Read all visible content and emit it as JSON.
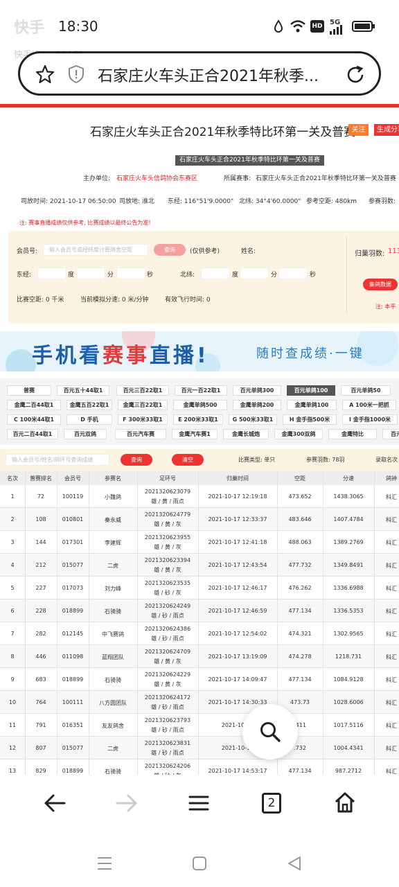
{
  "status": {
    "time": "18:30",
    "watermark": "快手",
    "watermark_id": "快手ID:qv01081",
    "battery": "",
    "signal": "5G"
  },
  "address_bar": {
    "title": "石家庄火车头正合2021年秋季..."
  },
  "page": {
    "title": "石家庄火车头正合2021年秋季特比环第一关及普赛",
    "follow_label": "关注",
    "share_label": "生成分享",
    "sub_banner": "石家庄火车头正合2021年秋季特比环第一关及普赛",
    "organizer_label": "主办单位:",
    "organizer": "石家庄火车头信鸽协会东赛区",
    "event_label": "所属赛事:",
    "event": "石家庄火车头正合2021年秋季特比环第一关及普赛",
    "release_time": "司放时间: 2021-10-17 06:50:00",
    "release_place": "司放地: 淮北",
    "longitude": "东经: 116°51'9.0000\"",
    "latitude": "北纬: 34°4'60.0000\"",
    "ref_distance": "参考空距: 480km",
    "entry_count": "参赛羽数:",
    "notice": "注: 赛事直播成绩仅供参考, 比赛成绩以最终公告为准!"
  },
  "search_panel": {
    "member_label": "会员号:",
    "member_placeholder": "输入会员号或经纬度计算随舍空距",
    "query_button": "查询",
    "query_note": "(仅供参考)",
    "name_label": "姓名:",
    "homing_label": "归巢羽数:",
    "homing_value": "113",
    "lon_label": "东经:",
    "lat_label": "北纬:",
    "deg": "度",
    "min": "分",
    "sec": "秒",
    "collect_button": "集鸽数据",
    "remark": "注: 本平",
    "distance": "比赛空距: 0 千米",
    "speed": "当前模拟分速: 0 米/分钟",
    "valid_time": "有效飞行时间: 0"
  },
  "ad": {
    "headline_pre": "手机看",
    "headline_hl": "赛事",
    "headline_post": "直播!",
    "tagline": "随时查成绩·一键"
  },
  "tabs": [
    [
      "普赛",
      "百元五十44取1",
      "百元三百22取1",
      "百元一百22取1",
      "百元单鸽300",
      "百元单鸽100",
      "百元单鸽50"
    ],
    [
      "金鹰二百44取1",
      "金鹰五百22取1",
      "金鹰三百22取1",
      "金鹰单鸽500",
      "金鹰单鸽200",
      "金鹰单鸽100",
      "A 100米一把抓"
    ],
    [
      "C 100米44取1",
      "D 手机",
      "F 300米33取1",
      "E 200米33取1",
      "G 500米33取1",
      "H 金手指500米",
      "I 金手指1000米"
    ],
    [
      "百元二百44取1",
      "百元双鸽",
      "百元汽车赛",
      "金鹰汽车赛1",
      "金鹰长城炮",
      "金鹰300双鸽",
      "金鹰特比",
      "百元"
    ]
  ],
  "active_tab": "百元单鸽100",
  "table_toolbar": {
    "search_placeholder": "输入会员号/姓名/鸽环号查询成绩",
    "query_button": "查询",
    "clear_button": "清空",
    "match_type": "比赛类型: 单只",
    "entries": "参赛羽数: 78羽",
    "admitted": "录取名次"
  },
  "table": {
    "headers": [
      "名次",
      "普赛排名",
      "会员号",
      "参赛名",
      "足环号",
      "归巢时间",
      "空距",
      "分速",
      "鸽钟"
    ],
    "rows": [
      [
        "1",
        "72",
        "100119",
        "小魏鸽",
        "2021320623079",
        "雄 / 黄 / 雨点",
        "2021-10-17 12:19:18",
        "473.652",
        "1438.3065",
        "科汇"
      ],
      [
        "2",
        "108",
        "010801",
        "秦永威",
        "2021320624779",
        "雄 / 黄 / 灰",
        "2021-10-17 12:33:37",
        "483.646",
        "1407.4784",
        "科汇"
      ],
      [
        "3",
        "144",
        "017301",
        "李建辉",
        "2021320623955",
        "雄 / 黄 / 灰",
        "2021-10-17 12:41:18",
        "488.063",
        "1389.2769",
        "科汇"
      ],
      [
        "4",
        "212",
        "015077",
        "二虎",
        "2021320623394",
        "雄 / 黄 / 灰",
        "2021-10-17 12:43:54",
        "477.732",
        "1349.8491",
        "科汇"
      ],
      [
        "5",
        "227",
        "017073",
        "刘力峰",
        "2021320623535",
        "雄 / 砂 / 灰",
        "2021-10-17 12:46:17",
        "476.262",
        "1336.6988",
        "科汇"
      ],
      [
        "6",
        "228",
        "018899",
        "石骑骑",
        "2021320624249",
        "雄 / 砂 / 雨点",
        "2021-10-17 12:46:59",
        "477.134",
        "1336.5353",
        "科汇"
      ],
      [
        "7",
        "282",
        "012145",
        "中飞赛鸽",
        "2021320624386",
        "雄 / 砂 / 雨点",
        "2021-10-17 12:54:02",
        "474.321",
        "1302.9565",
        "科汇"
      ],
      [
        "8",
        "446",
        "011098",
        "蓝翔团队",
        "2021320624709",
        "雄 / 黄 / 灰",
        "2021-10-17 13:19:09",
        "474.278",
        "1218.731",
        "科汇"
      ],
      [
        "9",
        "683",
        "018899",
        "石骑骑",
        "2021320624229",
        "雄 / 黄 / 灰",
        "2021-10-17 14:09:47",
        "477.134",
        "1084.9128",
        "科汇"
      ],
      [
        "10",
        "764",
        "100111",
        "八方圆团队",
        "2021320624172",
        "雄 / 砂 / 雨点",
        "2021-10-17 14:30:33",
        "473.73",
        "1028.6006",
        "科汇"
      ],
      [
        "11",
        "791",
        "016351",
        "友友鸽舍",
        "2021320623793",
        "雄 / 砂 / 雨点",
        "2021-10-17",
        ".411",
        "1017.5116",
        "科汇"
      ],
      [
        "12",
        "807",
        "015077",
        "二虎",
        "2021320623831",
        "雄 / 砂 / 雨点",
        "2021-10-17",
        ".732",
        "1004.4341",
        "科汇"
      ],
      [
        "13",
        "829",
        "018899",
        "石骑骑",
        "2021320624206",
        "雄 / 砂 / 灰",
        "2021-10-17 14:53:17",
        "477.134",
        "987.2712",
        "科汇"
      ]
    ]
  },
  "bottom_nav": {
    "tab_count": "2"
  }
}
